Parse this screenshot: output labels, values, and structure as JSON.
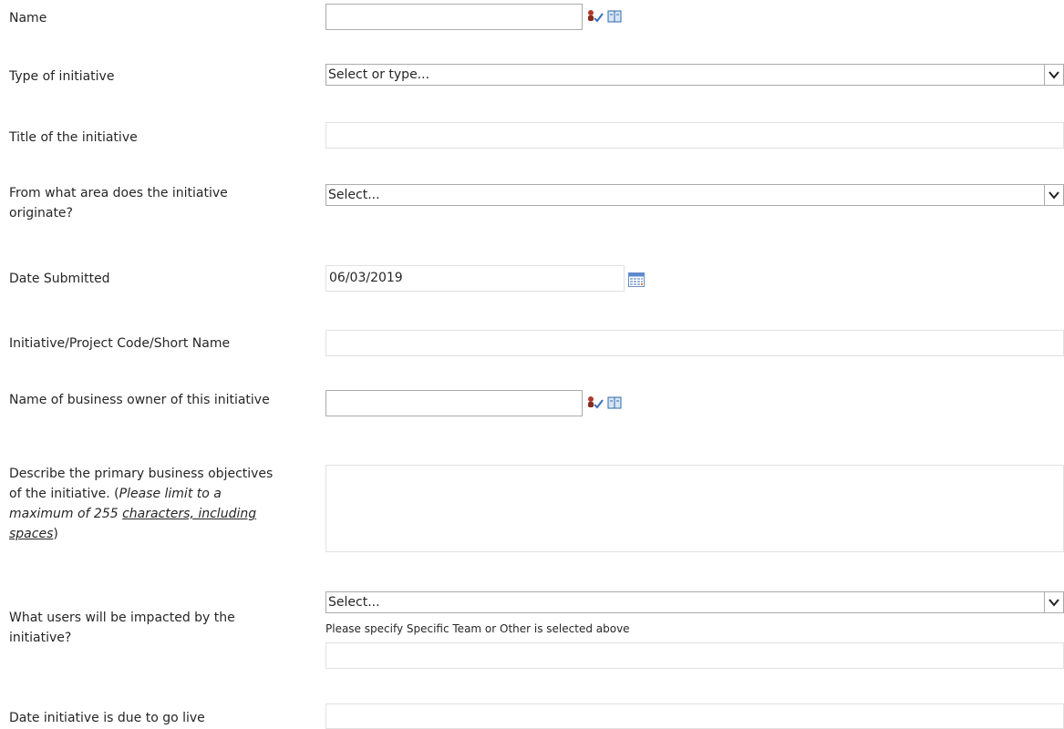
{
  "fields": {
    "name": {
      "label": "Name"
    },
    "type_of_initiative": {
      "label": "Type of initiative",
      "value": "Select or type..."
    },
    "title": {
      "label": "Title of the initiative"
    },
    "origin_area": {
      "label": "From what area does the initiative originate?",
      "value": "Select..."
    },
    "date_submitted": {
      "label": "Date Submitted",
      "value": "06/03/2019"
    },
    "project_code": {
      "label": "Initiative/Project Code/Short Name"
    },
    "business_owner": {
      "label": "Name of business owner of this initiative"
    },
    "objectives": {
      "label_prefix": "Describe the primary business objectives of the initiative. (",
      "label_italic_1": "Please limit to a maximum of 255 ",
      "label_italic_underlined": "characters, including spaces",
      "label_suffix": ")"
    },
    "users_impacted": {
      "label": "What users will be impacted by the initiative?",
      "value": "Select...",
      "hint": "Please specify  Specific Team or Other is selected above"
    },
    "go_live_date": {
      "label": "Date initiative is due to go live"
    }
  },
  "icons": {
    "check_names": "check-names-icon",
    "address_book": "address-book-icon",
    "calendar": "calendar-icon",
    "dropdown": "chevron-down-icon"
  },
  "colors": {
    "input_border": "#e1e1e1",
    "select_border": "#ababab",
    "text": "#262626"
  }
}
